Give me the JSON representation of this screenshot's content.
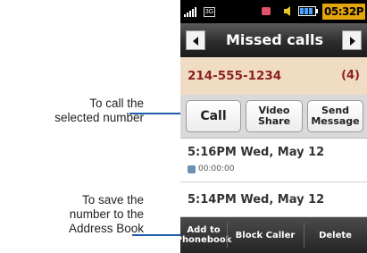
{
  "callouts": {
    "call_number": "To call the\nselected number",
    "save_number": "To save the\nnumber to the\nAddress Book"
  },
  "status": {
    "network_tag": "3G",
    "time": "05:32P"
  },
  "header": {
    "title": "Missed calls"
  },
  "caller": {
    "number": "214-555-1234",
    "count": "(4)"
  },
  "actions": {
    "call": "Call",
    "video_share": "Video\nShare",
    "send_message": "Send\nMessage"
  },
  "entries": [
    {
      "time": "5:16PM Wed, May 12",
      "duration": "00:00:00"
    },
    {
      "time": "5:14PM Wed, May 12"
    }
  ],
  "bottom_bar": {
    "add_to_phonebook": "Add to\nPhonebook",
    "block_caller": "Block Caller",
    "delete": "Delete"
  },
  "colors": {
    "callout_line": "#1f5fa8",
    "number_text": "#8c1f1f",
    "number_bar": "#f0dcc3",
    "clock_bg": "#e4a40b"
  }
}
